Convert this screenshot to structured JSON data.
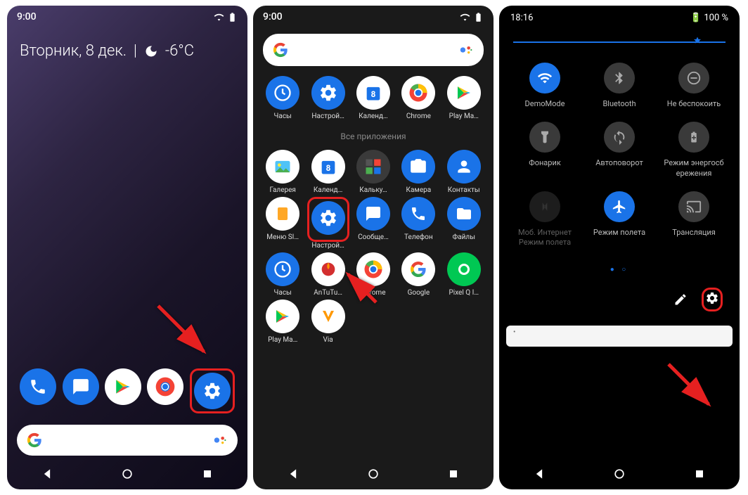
{
  "phone1": {
    "time": "9:00",
    "date": "Вторник, 8 дек.",
    "temp": "-6°C",
    "dock": [
      "phone-icon",
      "messages-icon",
      "play-store-icon",
      "chrome-icon",
      "settings-icon"
    ]
  },
  "phone2": {
    "time": "9:00",
    "fav_row": [
      {
        "label": "Часы",
        "icon": "clock-icon",
        "bg": "#1a73e8"
      },
      {
        "label": "Настрой…",
        "icon": "settings-icon",
        "bg": "#1a73e8"
      },
      {
        "label": "Календ…",
        "icon": "calendar-icon",
        "bg": "#fff"
      },
      {
        "label": "Chrome",
        "icon": "chrome-icon",
        "bg": "#fff"
      },
      {
        "label": "Play Ма…",
        "icon": "play-store-icon",
        "bg": "#fff"
      }
    ],
    "section_label": "Все приложения",
    "rows": [
      [
        {
          "label": "Галерея",
          "icon": "gallery-icon",
          "bg": "#fff"
        },
        {
          "label": "Календ…",
          "icon": "calendar-icon",
          "bg": "#fff"
        },
        {
          "label": "Кальку…",
          "icon": "calculator-icon",
          "bg": "#3a3a3a"
        },
        {
          "label": "Камера",
          "icon": "camera-icon",
          "bg": "#1a73e8"
        },
        {
          "label": "Контакты",
          "icon": "contacts-icon",
          "bg": "#1a73e8"
        }
      ],
      [
        {
          "label": "Меню SI…",
          "icon": "sim-icon",
          "bg": "#fff"
        },
        {
          "label": "Настрой…",
          "icon": "settings-icon",
          "bg": "#1a73e8",
          "highlight": true
        },
        {
          "label": "Сообще…",
          "icon": "messages-icon",
          "bg": "#1a73e8"
        },
        {
          "label": "Телефон",
          "icon": "phone-icon",
          "bg": "#1a73e8"
        },
        {
          "label": "Файлы",
          "icon": "files-icon",
          "bg": "#1a73e8"
        }
      ],
      [
        {
          "label": "Часы",
          "icon": "clock-icon",
          "bg": "#1a73e8"
        },
        {
          "label": "AnTuTu…",
          "icon": "antutu-icon",
          "bg": "#fff"
        },
        {
          "label": "Chrome",
          "icon": "chrome-icon",
          "bg": "#fff"
        },
        {
          "label": "Google",
          "icon": "google-icon",
          "bg": "#fff"
        },
        {
          "label": "Pixel Q I…",
          "icon": "pixel-icon",
          "bg": "#00c853"
        }
      ],
      [
        {
          "label": "Play Ма…",
          "icon": "play-store-icon",
          "bg": "#fff"
        },
        {
          "label": "Via",
          "icon": "via-icon",
          "bg": "#fff"
        }
      ]
    ]
  },
  "phone3": {
    "time": "18:16",
    "battery": "100 %",
    "rows": [
      [
        {
          "label": "DemoMode",
          "icon": "wifi-icon",
          "on": true
        },
        {
          "label": "Bluetooth",
          "icon": "bluetooth-icon",
          "on": false
        },
        {
          "label": "Не беспокоить",
          "icon": "dnd-icon",
          "on": false
        }
      ],
      [
        {
          "label": "Фонарик",
          "icon": "flashlight-icon",
          "on": false
        },
        {
          "label": "Автоповорот",
          "icon": "rotate-icon",
          "on": false
        },
        {
          "label": "Режим энергосб\nережения",
          "icon": "battery-saver-icon",
          "on": false
        }
      ],
      [
        {
          "label": "Моб. Интернет\nРежим полета",
          "icon": "data-icon",
          "on": false,
          "dim": true
        },
        {
          "label": "Режим полета",
          "icon": "airplane-icon",
          "on": true
        },
        {
          "label": "Трансляция",
          "icon": "cast-icon",
          "on": false
        }
      ]
    ]
  }
}
